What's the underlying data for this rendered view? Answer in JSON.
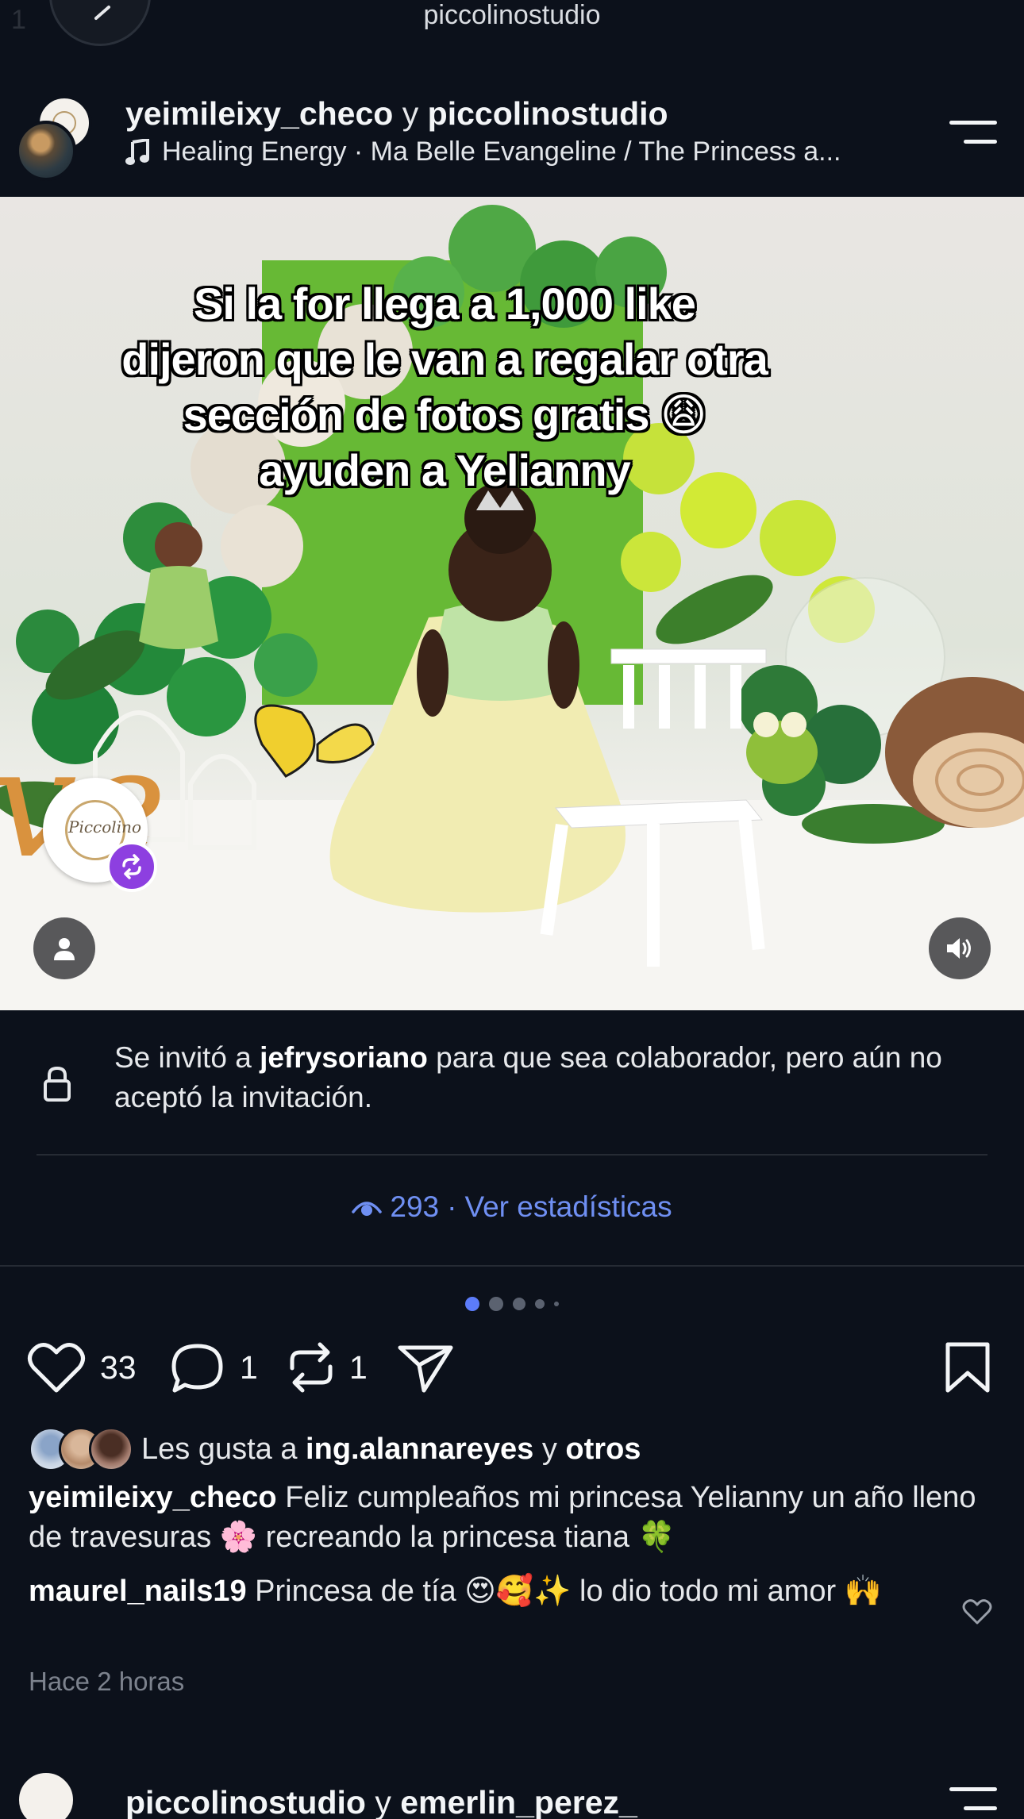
{
  "topbar": {
    "title": "piccolinostudio",
    "faded_counter": "1"
  },
  "post": {
    "author": "yeimileixy_checo",
    "connector": "y",
    "collaborator": "piccolinostudio",
    "music": "Healing Energy · Ma Belle Evangeline / The Princess a...",
    "overlay_text": "Si la for llega a 1,000 like dijeron que le van a regalar otra sección de fotos gratis 😩ayuden a Yelianny",
    "remix_badge_text": "Piccolino"
  },
  "collab_notice": {
    "prefix": "Se invitó a ",
    "user": "jefrysoriano",
    "suffix": " para que sea colaborador, pero aún no aceptó la invitación."
  },
  "stats": {
    "views": "293",
    "separator": "·",
    "link": "Ver estadísticas"
  },
  "actions": {
    "likes_count": "33",
    "comments_count": "1",
    "reposts_count": "1"
  },
  "likes_line": {
    "prefix": "Les gusta a ",
    "user": "ing.alannareyes",
    "connector": " y ",
    "others": "otros"
  },
  "caption": {
    "user": "yeimileixy_checo",
    "text": " Feliz cumpleaños mi princesa Yelianny un año lleno de travesuras 🌸 recreando la princesa tiana 🍀"
  },
  "comment": {
    "user": "maurel_nails19",
    "text": " Princesa de tía 😍🥰✨ lo dio todo mi amor 🙌"
  },
  "time_ago": "Hace 2 horas",
  "next_post": {
    "author": "piccolinostudio",
    "connector": "y",
    "collaborator": "emerlin_perez_"
  },
  "colors": {
    "background": "#0c111b",
    "link_blue": "#6f8ff2",
    "dot_active": "#5c7cfa",
    "remix_purple": "#8d3fe0"
  }
}
